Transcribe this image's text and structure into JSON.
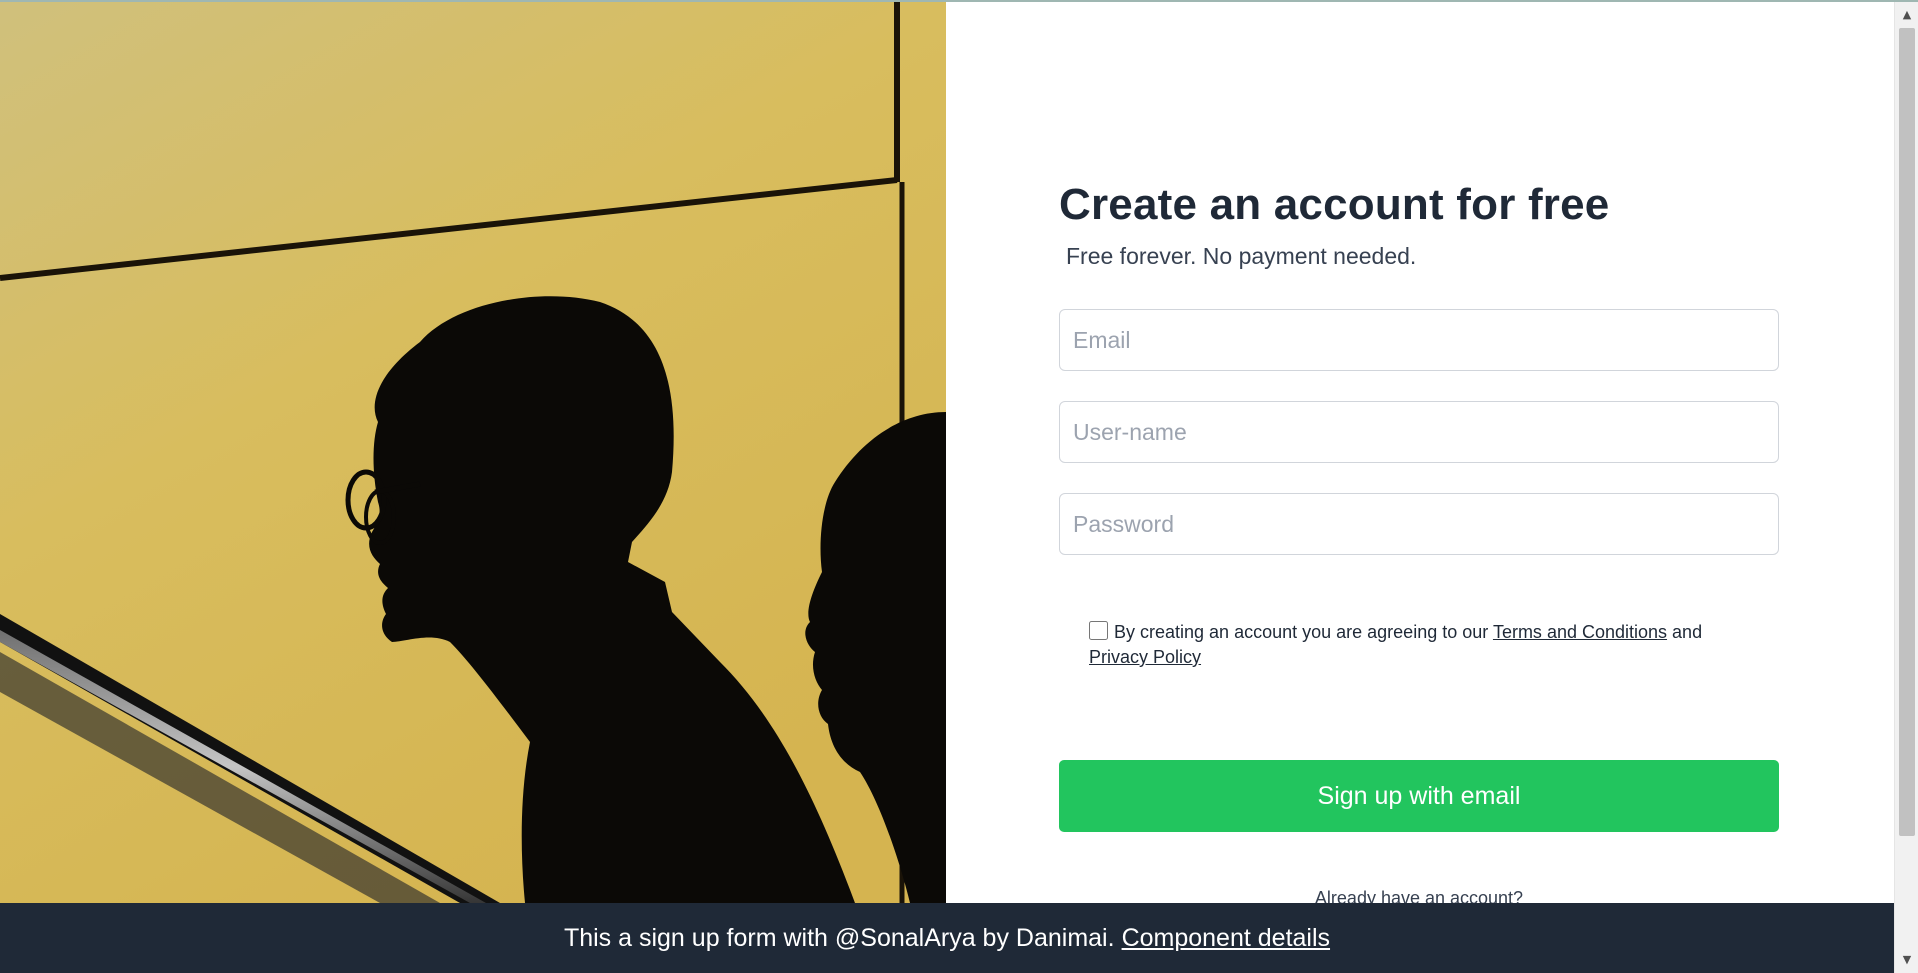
{
  "photo": {
    "description_icon": "photo-icon"
  },
  "form": {
    "title": "Create an account for free",
    "subtitle": "Free forever. No payment needed.",
    "email_placeholder": "Email",
    "username_placeholder": "User-name",
    "password_placeholder": "Password",
    "agree_prefix": "By creating an account you are agreeing to our",
    "terms_link": "Terms and Conditions",
    "agree_and": "and",
    "privacy_link": "Privacy Policy",
    "signup_button": "Sign up with email",
    "already_account": "Already have an account?",
    "accent_color": "#22c55e"
  },
  "banner": {
    "text": "This a sign up form with @SonalArya by Danimai.",
    "link": "Component details",
    "background_color": "#1f2937"
  },
  "scrollbar": {
    "up_icon": "chevron-up-icon",
    "down_icon": "chevron-down-icon"
  }
}
